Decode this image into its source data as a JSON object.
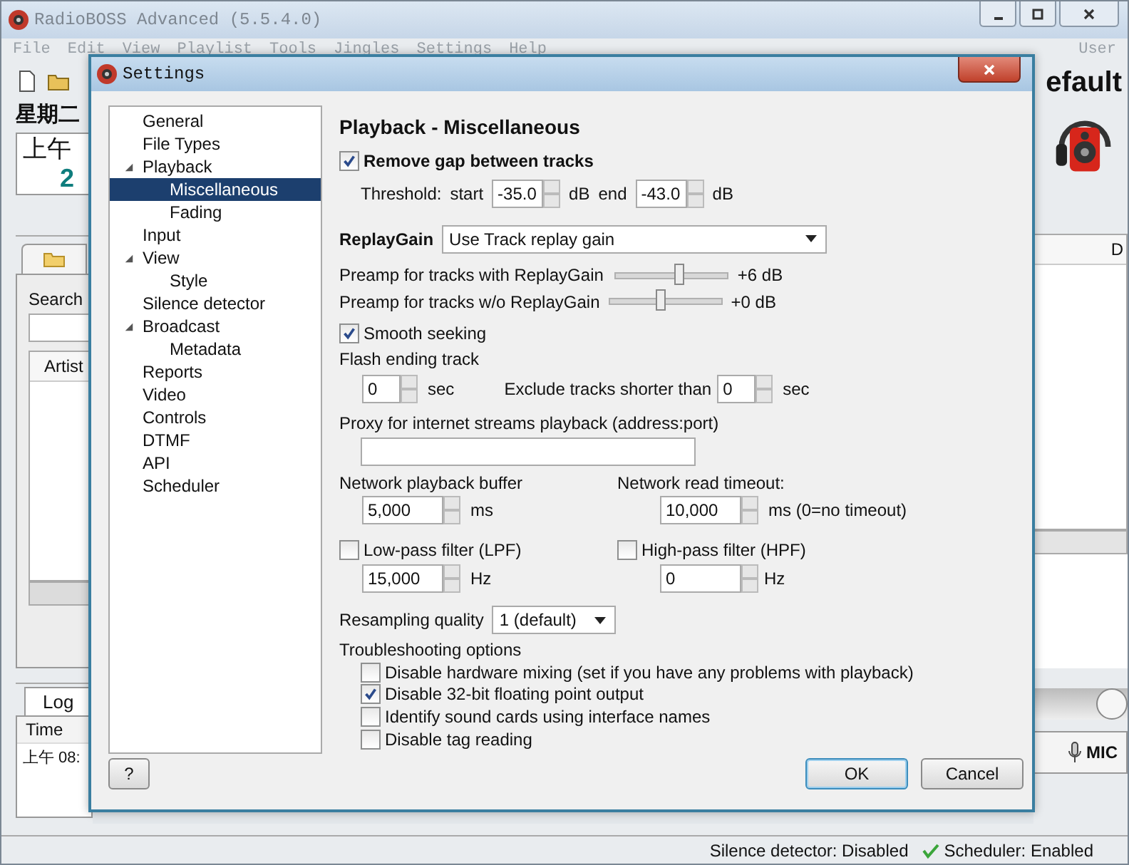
{
  "main_window": {
    "title": "RadioBOSS Advanced (5.5.4.0)",
    "menu": [
      "File",
      "Edit",
      "View",
      "Playlist",
      "Tools",
      "Jingles",
      "Settings",
      "Help"
    ],
    "user_menu": "User",
    "left_panel": {
      "day": "星期二",
      "time": "上午",
      "date_part": "2",
      "search_label": "Search",
      "column": "Artist",
      "log_tab": "Log",
      "log_column": "Time",
      "log_entry": "上午 08:"
    },
    "right_panel": {
      "profile": "efault",
      "column": "D",
      "volume": {
        "level": 1
      },
      "mic_button": "MIC"
    },
    "status_bar": [
      {
        "text": "Silence detector: Disabled",
        "kind": "plain"
      },
      {
        "text": "Scheduler: Enabled",
        "kind": "ok"
      }
    ]
  },
  "dialog": {
    "title": "Settings",
    "tree": [
      {
        "label": "General",
        "selected": false
      },
      {
        "label": "File Types",
        "selected": false
      },
      {
        "label": "Playback",
        "selected": false,
        "expanded": true,
        "children": [
          {
            "label": "Miscellaneous",
            "selected": true
          },
          {
            "label": "Fading",
            "selected": false
          }
        ]
      },
      {
        "label": "Input",
        "selected": false
      },
      {
        "label": "View",
        "selected": false,
        "expanded": true,
        "children": [
          {
            "label": "Style",
            "selected": false
          }
        ]
      },
      {
        "label": "Silence detector",
        "selected": false
      },
      {
        "label": "Broadcast",
        "selected": false,
        "expanded": true,
        "children": [
          {
            "label": "Metadata",
            "selected": false
          }
        ]
      },
      {
        "label": "Reports",
        "selected": false
      },
      {
        "label": "Video",
        "selected": false
      },
      {
        "label": "Controls",
        "selected": false
      },
      {
        "label": "DTMF",
        "selected": false
      },
      {
        "label": "API",
        "selected": false
      },
      {
        "label": "Scheduler",
        "selected": false
      }
    ],
    "heading": "Playback - Miscellaneous",
    "remove_gap": {
      "label": "Remove gap between tracks",
      "checked": true
    },
    "threshold": {
      "label": "Threshold:",
      "start_label": "start",
      "start_value": "-35.0",
      "start_unit": "dB",
      "end_label": "end",
      "end_value": "-43.0",
      "end_unit": "dB"
    },
    "replaygain": {
      "label": "ReplayGain",
      "value": "Use Track replay gain"
    },
    "preamps": [
      {
        "label": "Preamp for tracks with ReplayGain",
        "level": 0.57,
        "reading": "+6 dB"
      },
      {
        "label": "Preamp for tracks w/o ReplayGain",
        "level": 0.47,
        "reading": "+0 dB"
      }
    ],
    "smooth_seeking": {
      "label": "Smooth seeking",
      "checked": true
    },
    "flash": {
      "label": "Flash ending track",
      "value": "0",
      "unit": "sec",
      "exclude_label": "Exclude tracks shorter than",
      "exclude_value": "0",
      "exclude_unit": "sec"
    },
    "proxy": {
      "label": "Proxy for internet streams playback (address:port)"
    },
    "buffer": {
      "label": "Network playback buffer",
      "value": "5,000",
      "unit": "ms"
    },
    "timeout": {
      "label": "Network read timeout:",
      "value": "10,000",
      "unit": "ms (0=no timeout)"
    },
    "lpf": {
      "label": "Low-pass filter (LPF)",
      "checked": false,
      "value": "15,000",
      "unit": "Hz"
    },
    "hpf": {
      "label": "High-pass filter (HPF)",
      "checked": false,
      "value": "0",
      "unit": "Hz"
    },
    "resampling": {
      "label": "Resampling quality",
      "value": "1 (default)"
    },
    "troubleshooting": {
      "label": "Troubleshooting options",
      "options": [
        {
          "label": "Disable hardware mixing (set if you have any problems with playback)",
          "checked": false
        },
        {
          "label": "Disable 32-bit floating point output",
          "checked": true
        },
        {
          "label": "Identify sound cards using interface names",
          "checked": false
        },
        {
          "label": "Disable tag reading",
          "checked": false
        }
      ]
    },
    "help_button": "?",
    "ok_button": "OK",
    "cancel_button": "Cancel"
  }
}
